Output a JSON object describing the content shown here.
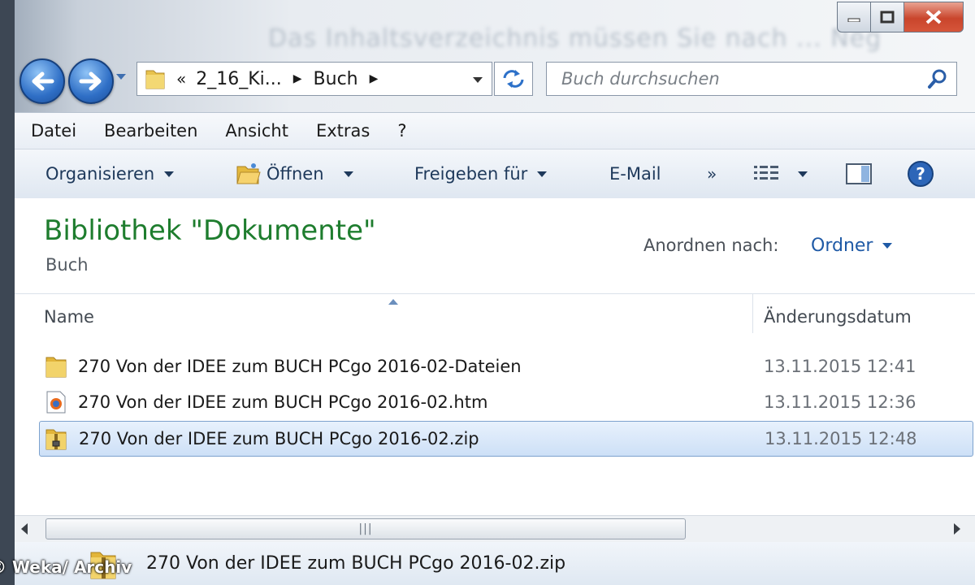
{
  "window": {
    "controls": {
      "minimize": "minimize-icon",
      "maximize": "maximize-icon",
      "close": "close-icon"
    }
  },
  "background_text": "Das Inhaltsverzeichnis müssen Sie nach ... Neg",
  "nav": {
    "back_icon": "arrow-left-icon",
    "forward_icon": "arrow-right-icon",
    "address": {
      "prefix": "«",
      "segments": [
        "2_16_Ki...",
        "Buch"
      ]
    },
    "search_placeholder": "Buch durchsuchen"
  },
  "menubar": [
    "Datei",
    "Bearbeiten",
    "Ansicht",
    "Extras",
    "?"
  ],
  "commandbar": {
    "organize": "Organisieren",
    "open": "Öffnen",
    "share": "Freigeben für",
    "email": "E-Mail",
    "more": "»"
  },
  "library": {
    "title": "Bibliothek \"Dokumente\"",
    "subtitle": "Buch",
    "arrange_label": "Anordnen nach:",
    "arrange_value": "Ordner"
  },
  "columns": {
    "name": "Name",
    "date": "Änderungsdatum"
  },
  "files": [
    {
      "name": "270 Von der IDEE zum BUCH PCgo 2016-02-Dateien",
      "date": "13.11.2015 12:41",
      "icon": "folder-icon"
    },
    {
      "name": "270 Von der IDEE zum BUCH PCgo 2016-02.htm",
      "date": "13.11.2015 12:36",
      "icon": "firefox-html-icon"
    },
    {
      "name": "270 Von der IDEE zum BUCH PCgo 2016-02.zip",
      "date": "13.11.2015 12:48",
      "icon": "zip-folder-icon",
      "selected": true
    }
  ],
  "details": {
    "name": "270 Von der IDEE zum BUCH PCgo 2016-02.zip"
  },
  "credit": "© Weka/ Archiv",
  "colors": {
    "library_title": "#1e7d2e",
    "link": "#1f5aa6",
    "selection": "#cde0f7"
  }
}
